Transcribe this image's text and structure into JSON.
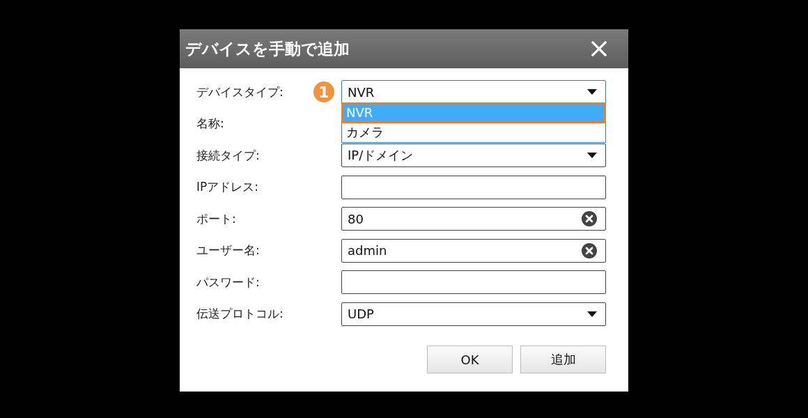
{
  "dialog": {
    "title": "デバイスを手動で追加",
    "fields": [
      {
        "label": "デバイスタイプ:",
        "kind": "select",
        "value": "NVR",
        "open": true,
        "options": [
          {
            "label": "NVR",
            "selected": true
          },
          {
            "label": "カメラ",
            "selected": false
          }
        ],
        "callout": "1"
      },
      {
        "label": "名称:",
        "kind": "text"
      },
      {
        "label": "接続タイプ:",
        "kind": "select",
        "value": "IP/ドメイン",
        "open": false
      },
      {
        "label": "IPアドレス:",
        "kind": "text"
      },
      {
        "label": "ポート:",
        "kind": "clearable",
        "value": "80"
      },
      {
        "label": "ユーザー名:",
        "kind": "clearable",
        "value": "admin"
      },
      {
        "label": "パスワード:",
        "kind": "text"
      },
      {
        "label": "伝送プロトコル:",
        "kind": "select",
        "value": "UDP",
        "open": false
      }
    ],
    "buttons": [
      "OK",
      "追加"
    ]
  }
}
